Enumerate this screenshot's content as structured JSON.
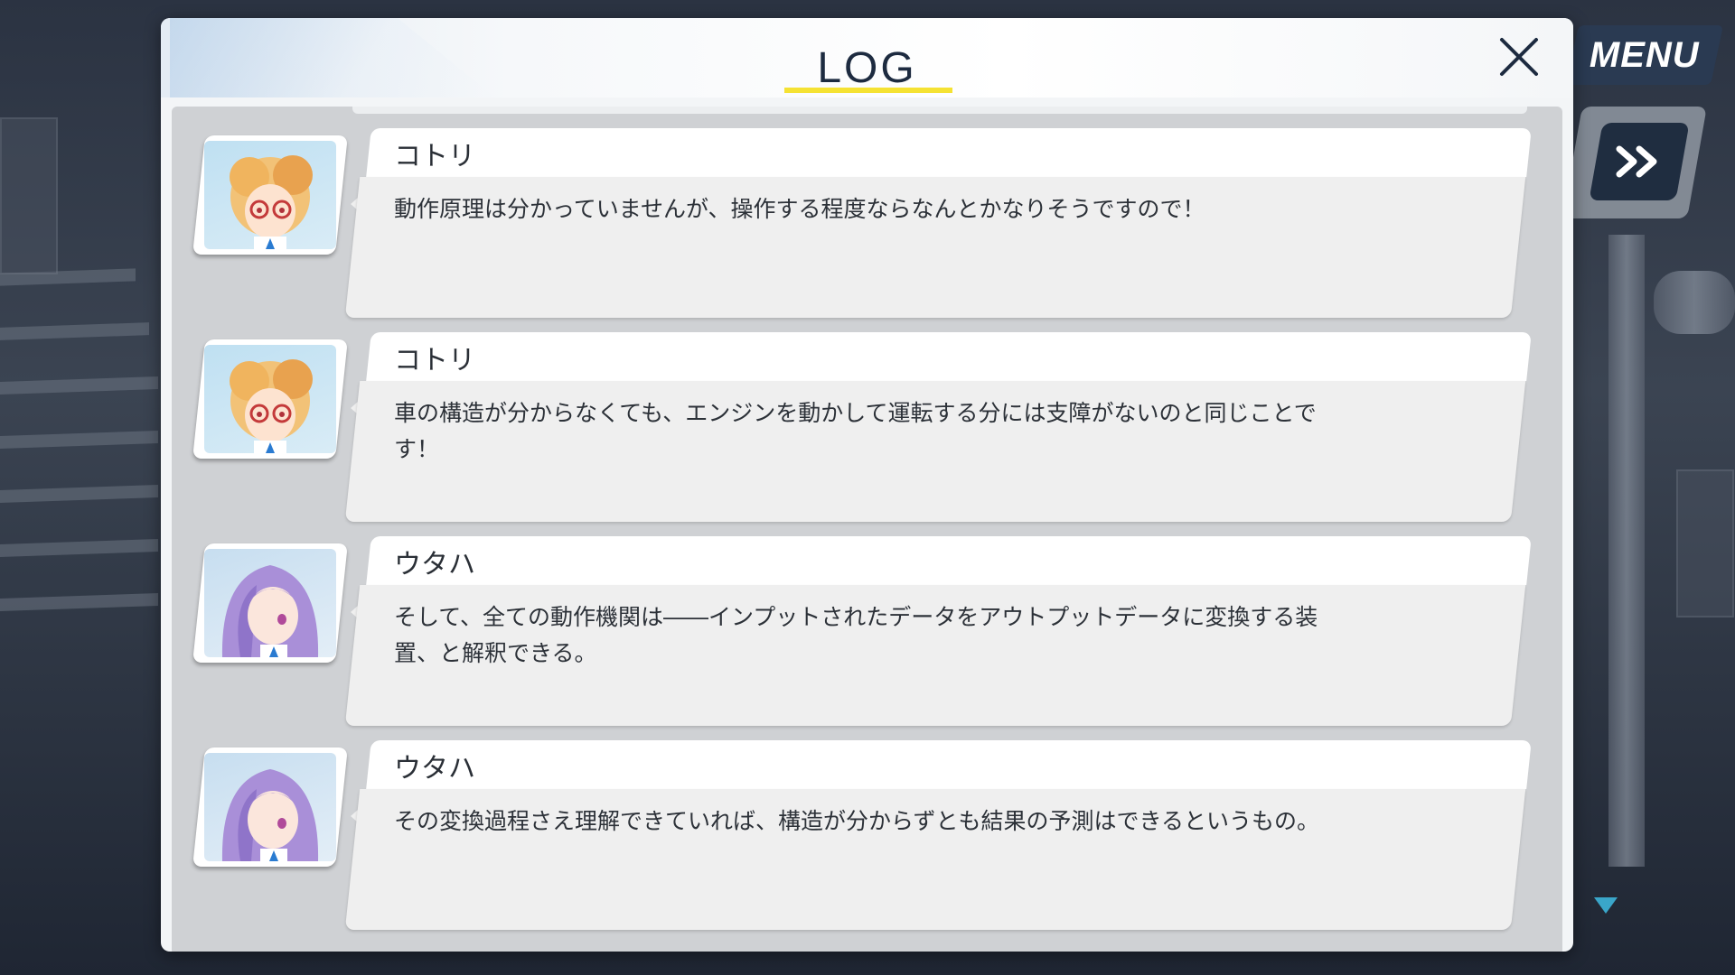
{
  "header": {
    "title": "LOG"
  },
  "controls": {
    "menu_label": "MENU"
  },
  "log_entries": [
    {
      "speaker": "コトリ",
      "text": "動作原理は分かっていませんが、操作する程度ならなんとかなりそうですので！"
    },
    {
      "speaker": "コトリ",
      "text": "車の構造が分からなくても、エンジンを動かして運転する分には支障がないのと同じことです！"
    },
    {
      "speaker": "ウタハ",
      "text": "そして、全ての動作機関は――インプットされたデータをアウトプットデータに変換する装置、と解釈できる。"
    },
    {
      "speaker": "ウタハ",
      "text": "その変換過程さえ理解できていれば、構造が分からずとも結果の予測はできるというもの。"
    }
  ],
  "colors": {
    "title_underline": "#f5e233",
    "title_text": "#1d2b40",
    "menu_bg": "#2a3a52"
  },
  "icons": [
    "close-icon",
    "fast-forward-icon",
    "scroll-down-icon"
  ]
}
